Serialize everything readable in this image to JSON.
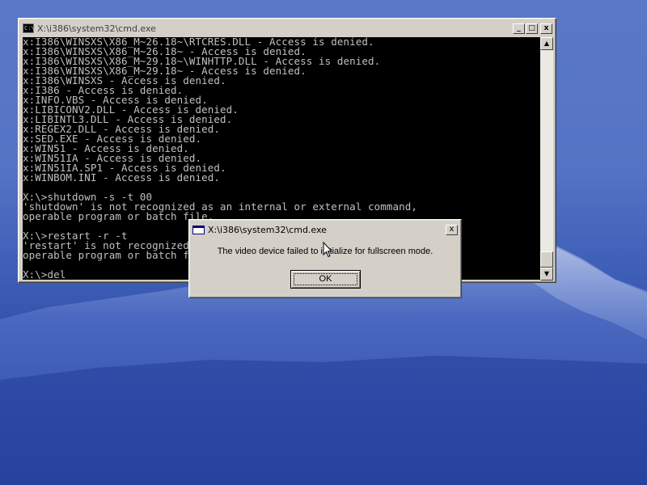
{
  "desktop": {
    "wallpaper_colors": [
      "#5b78c8",
      "#3f5fb8",
      "#1f3c98"
    ]
  },
  "cmd_window": {
    "title": "X:\\i386\\system32\\cmd.exe",
    "icon": "cmd-icon",
    "icon_text": "C:\\",
    "minimize_label": "_",
    "maximize_label": "□",
    "close_label": "x",
    "console_lines": [
      "x:I386\\WINSXS\\X86_M~26.18~\\RTCRES.DLL - Access is denied.",
      "x:I386\\WINSXS\\X86_M~26.18~ - Access is denied.",
      "x:I386\\WINSXS\\X86_M~29.18~\\WINHTTP.DLL - Access is denied.",
      "x:I386\\WINSXS\\X86_M~29.18~ - Access is denied.",
      "x:I386\\WINSXS - Access is denied.",
      "x:I386 - Access is denied.",
      "x:INFO.VBS - Access is denied.",
      "x:LIBICONV2.DLL - Access is denied.",
      "x:LIBINTL3.DLL - Access is denied.",
      "x:REGEX2.DLL - Access is denied.",
      "x:SED.EXE - Access is denied.",
      "x:WIN51 - Access is denied.",
      "x:WIN51IA - Access is denied.",
      "x:WIN51IA.SP1 - Access is denied.",
      "x:WINBOM.INI - Access is denied.",
      "",
      "X:\\>shutdown -s -t 00",
      "'shutdown' is not recognized as an internal or external command,",
      "operable program or batch file.",
      "",
      "X:\\>restart -r -t",
      "'restart' is not recognized as an internal or external command,",
      "operable program or batch file.",
      "",
      "X:\\>del"
    ],
    "console_text_color": "#c0c0c0",
    "console_bg": "#000000"
  },
  "dialog": {
    "title": "X:\\i386\\system32\\cmd.exe",
    "message": "The video device failed to initialize for fullscreen mode.",
    "ok_label": "OK",
    "close_label": "x"
  }
}
